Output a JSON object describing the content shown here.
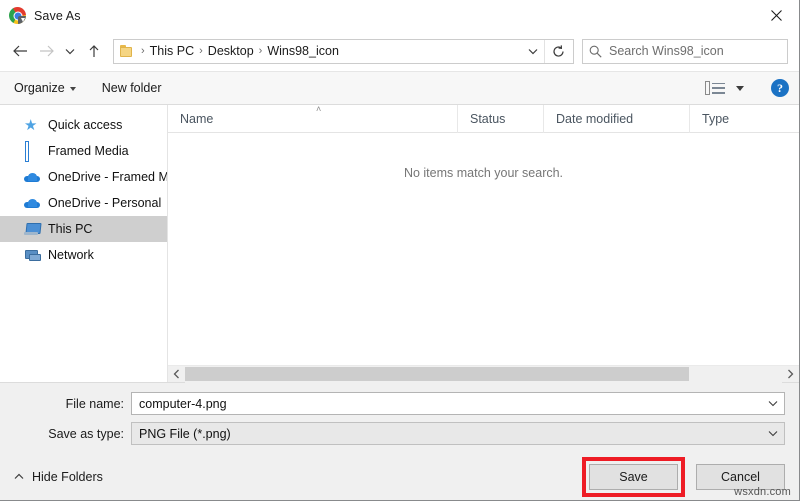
{
  "window": {
    "title": "Save As",
    "app_icon": "chrome-download-icon",
    "close_label": "✕"
  },
  "navigation": {
    "back_icon": "arrow-left-icon",
    "forward_icon": "arrow-right-icon",
    "recent_icon": "chevron-down-icon",
    "up_icon": "arrow-up-icon",
    "refresh_icon": "refresh-icon",
    "dropdown_icon": "chevron-down-icon",
    "breadcrumb_folder_icon": "folder-icon",
    "separator": "›",
    "breadcrumb": [
      "This PC",
      "Desktop",
      "Wins98_icon"
    ]
  },
  "search": {
    "icon": "search-icon",
    "placeholder": "Search Wins98_icon"
  },
  "toolbar": {
    "organize_label": "Organize",
    "new_folder_label": "New folder",
    "view_icon": "list-view-icon",
    "view_caret_icon": "chevron-down-icon",
    "help_label": "?"
  },
  "sidebar": {
    "items": [
      {
        "label": "Quick access",
        "icon": "star-icon",
        "selected": false
      },
      {
        "label": "Framed Media",
        "icon": "building-icon",
        "selected": false
      },
      {
        "label": "OneDrive - Framed M",
        "icon": "cloud-icon",
        "selected": false
      },
      {
        "label": "OneDrive - Personal",
        "icon": "cloud-icon",
        "selected": false
      },
      {
        "label": "This PC",
        "icon": "this-pc-icon",
        "selected": true
      },
      {
        "label": "Network",
        "icon": "network-icon",
        "selected": false
      }
    ]
  },
  "filelist": {
    "columns": [
      "Name",
      "Status",
      "Date modified",
      "Type"
    ],
    "sort_column": "Name",
    "sort_indicator": "˄",
    "rows": [],
    "empty_message": "No items match your search.",
    "scroll_left_icon": "chevron-left-icon",
    "scroll_right_icon": "chevron-right-icon"
  },
  "form": {
    "file_name_label": "File name:",
    "file_name_value": "computer-4.png",
    "save_as_type_label": "Save as type:",
    "save_as_type_value": "PNG File (*.png)",
    "dropdown_icon": "chevron-down-icon"
  },
  "footer": {
    "hide_folders_label": "Hide Folders",
    "hide_folders_icon": "chevron-up-icon",
    "save_label": "Save",
    "cancel_label": "Cancel"
  },
  "annotation": {
    "highlight_target": "Save",
    "highlight_color": "#ee1c25"
  },
  "watermark": {
    "text": "wsxdn.com"
  }
}
